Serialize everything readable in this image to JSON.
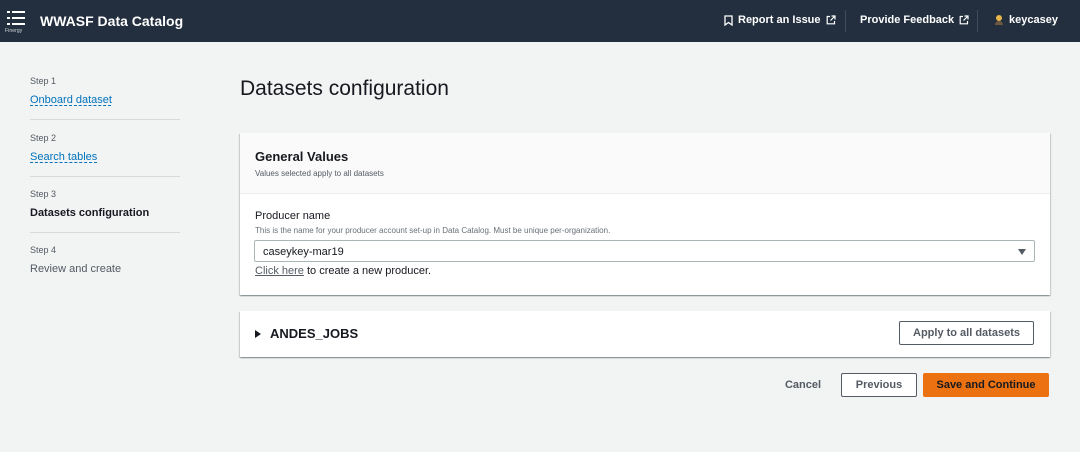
{
  "header": {
    "menu_sublabel": "Finergy",
    "app_title": "WWASF Data Catalog",
    "report_issue": "Report an Issue",
    "feedback": "Provide Feedback",
    "username": "keycasey"
  },
  "steps": [
    {
      "num": "Step 1",
      "label": "Onboard dataset",
      "state": "link"
    },
    {
      "num": "Step 2",
      "label": "Search tables",
      "state": "link"
    },
    {
      "num": "Step 3",
      "label": "Datasets configuration",
      "state": "current"
    },
    {
      "num": "Step 4",
      "label": "Review and create",
      "state": "disabled"
    }
  ],
  "page_title": "Datasets configuration",
  "general": {
    "title": "General Values",
    "description": "Values selected apply to all datasets",
    "producer_label": "Producer name",
    "producer_desc": "This is the name for your producer account set-up in Data Catalog. Must be unique per-organization.",
    "producer_value": "caseykey-mar19",
    "click_here": "Click here",
    "create_text": " to create a new producer."
  },
  "dataset": {
    "name": "ANDES_JOBS",
    "apply_button": "Apply to all datasets"
  },
  "actions": {
    "cancel": "Cancel",
    "previous": "Previous",
    "save": "Save and Continue"
  },
  "colors": {
    "header_bg": "#232f3e",
    "primary": "#ec7211",
    "link": "#0073bb",
    "page_bg": "#f2f3f3"
  }
}
